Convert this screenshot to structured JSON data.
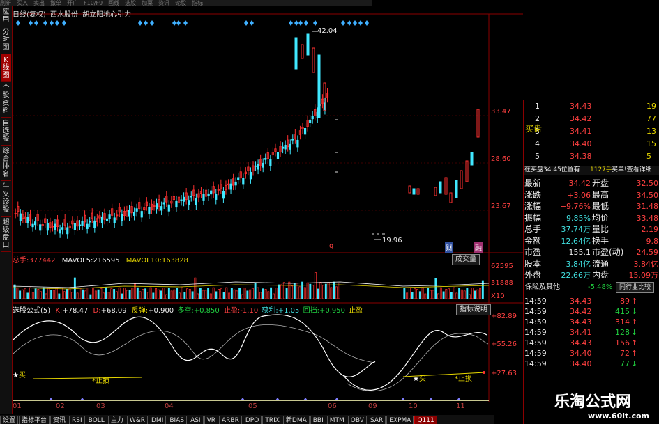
{
  "menubar": [
    "刷新",
    "买入",
    "卖出",
    "撤单",
    "开户",
    "F10/F9",
    "画线",
    "选股",
    "加菜",
    "资讯",
    "论股",
    "指标"
  ],
  "leftnav": [
    {
      "label": "应用",
      "active": false
    },
    {
      "label": "分时图",
      "active": false
    },
    {
      "label": "K线图",
      "active": true
    },
    {
      "label": "个股资料",
      "active": false
    },
    {
      "label": "自选股",
      "active": false
    },
    {
      "label": "综合排名",
      "active": false
    },
    {
      "label": "牛叉诊股",
      "active": false
    },
    {
      "label": "超级盘口",
      "active": false
    }
  ],
  "header": {
    "period": "日线(复权)",
    "stock": "西水股份",
    "indicator": "胡立阳地心引力"
  },
  "price_axis": [
    "33.47",
    "28.60",
    "23.67"
  ],
  "annotations": {
    "high": "42.04",
    "low": "19.96",
    "marker_q": "q",
    "badge_cai": "财",
    "badge_rong": "融"
  },
  "volume": {
    "total_label": "总手:",
    "total_value": "377442",
    "ma5_label": "MAVOL5:",
    "ma5_value": "216595",
    "ma10_label": "MAVOL10:",
    "ma10_value": "163828",
    "button": "成交量",
    "axis": [
      "62595",
      "31888",
      "X10"
    ]
  },
  "indicator": {
    "name": "选股公式(5)",
    "k_label": "K:",
    "k_value": "+78.47",
    "d_label": "D:",
    "d_value": "+68.09",
    "fantan_label": "反弹:",
    "fantan_value": "+0.900",
    "duokong_label": "多空:",
    "duokong_value": "+0.850",
    "zhiying_label": "止盈:",
    "zhiying_value": "-1.10",
    "zhuli_label": "获利:",
    "zhuli_value": "+1.05",
    "huidang_label": "回挡:",
    "huidang_value": "+0.950",
    "zhiying2": "止盈",
    "button": "指标说明",
    "axis": [
      "+82.89",
      "+55.26",
      "+27.63"
    ],
    "buy_left": "买",
    "stop_left": "止损",
    "buy_right": "买",
    "stop_right": "止损"
  },
  "xaxis": [
    "01",
    "02",
    "03",
    "04",
    "05",
    "06",
    "09",
    "10",
    "11"
  ],
  "tabs": [
    "设置",
    "指标平台",
    "资讯",
    "RSI",
    "BOLL",
    "主力",
    "W&R",
    "DMI",
    "BIAS",
    "ASI",
    "VR",
    "ARBR",
    "DPO",
    "TRIX",
    "新DMA",
    "BBI",
    "MTM",
    "OBV",
    "SAR",
    "EXPMA",
    "Q111"
  ],
  "orderbook": {
    "side_label": "买盘",
    "rows": [
      {
        "lvl": "1",
        "price": "34.43",
        "vol": "19"
      },
      {
        "lvl": "2",
        "price": "34.42",
        "vol": "77"
      },
      {
        "lvl": "3",
        "price": "34.41",
        "vol": "13"
      },
      {
        "lvl": "4",
        "price": "34.40",
        "vol": "15"
      },
      {
        "lvl": "5",
        "price": "34.38",
        "vol": "5"
      }
    ],
    "info": "在买盘34.45位置有",
    "info_vol": "1127手",
    "info_btn": "买单!查看详细"
  },
  "quote": [
    {
      "l1": "最新",
      "v1": "34.42",
      "l2": "开盘",
      "v2": "32.50"
    },
    {
      "l1": "涨跌",
      "v1": "+3.06",
      "l2": "最高",
      "v2": "34.50"
    },
    {
      "l1": "涨幅",
      "v1": "+9.76%",
      "l2": "最低",
      "v2": "31.48"
    },
    {
      "l1": "振幅",
      "v1": "9.85%",
      "l2": "均价",
      "v2": "33.48"
    },
    {
      "l1": "总手",
      "v1": "37.74万",
      "l2": "量比",
      "v2": "2.19"
    },
    {
      "l1": "金额",
      "v1": "12.64亿",
      "l2": "换手",
      "v2": "9.8"
    },
    {
      "l1": "市盈",
      "v1": "155.1",
      "l2": "市盈(动)",
      "v2": "24.59"
    },
    {
      "l1": "股本",
      "v1": "3.84亿",
      "l2": "流通",
      "v2": "3.84亿"
    },
    {
      "l1": "外盘",
      "v1": "22.66万",
      "l2": "内盘",
      "v2": "15.09万"
    }
  ],
  "sector": {
    "name": "保险及其他",
    "change": "-5.48%",
    "button": "同行业比较"
  },
  "trades": [
    {
      "time": "14:59",
      "price": "34.43",
      "vol": "89",
      "dir": "up"
    },
    {
      "time": "14:59",
      "price": "34.42",
      "vol": "415",
      "dir": "down"
    },
    {
      "time": "14:59",
      "price": "34.43",
      "vol": "314",
      "dir": "up"
    },
    {
      "time": "14:59",
      "price": "34.41",
      "vol": "128",
      "dir": "down"
    },
    {
      "time": "14:59",
      "price": "34.43",
      "vol": "156",
      "dir": "up"
    },
    {
      "time": "14:59",
      "price": "34.40",
      "vol": "72",
      "dir": "up"
    },
    {
      "time": "14:59",
      "price": "34.40",
      "vol": "77",
      "dir": "down"
    }
  ],
  "brand": {
    "name": "乐淘公式网",
    "url": "www.60lt.com"
  },
  "colors": {
    "up": "#ff4040",
    "down": "#20d040",
    "accent": "#8b0000",
    "bull": "#ff3030",
    "bear": "#40e8ff"
  }
}
